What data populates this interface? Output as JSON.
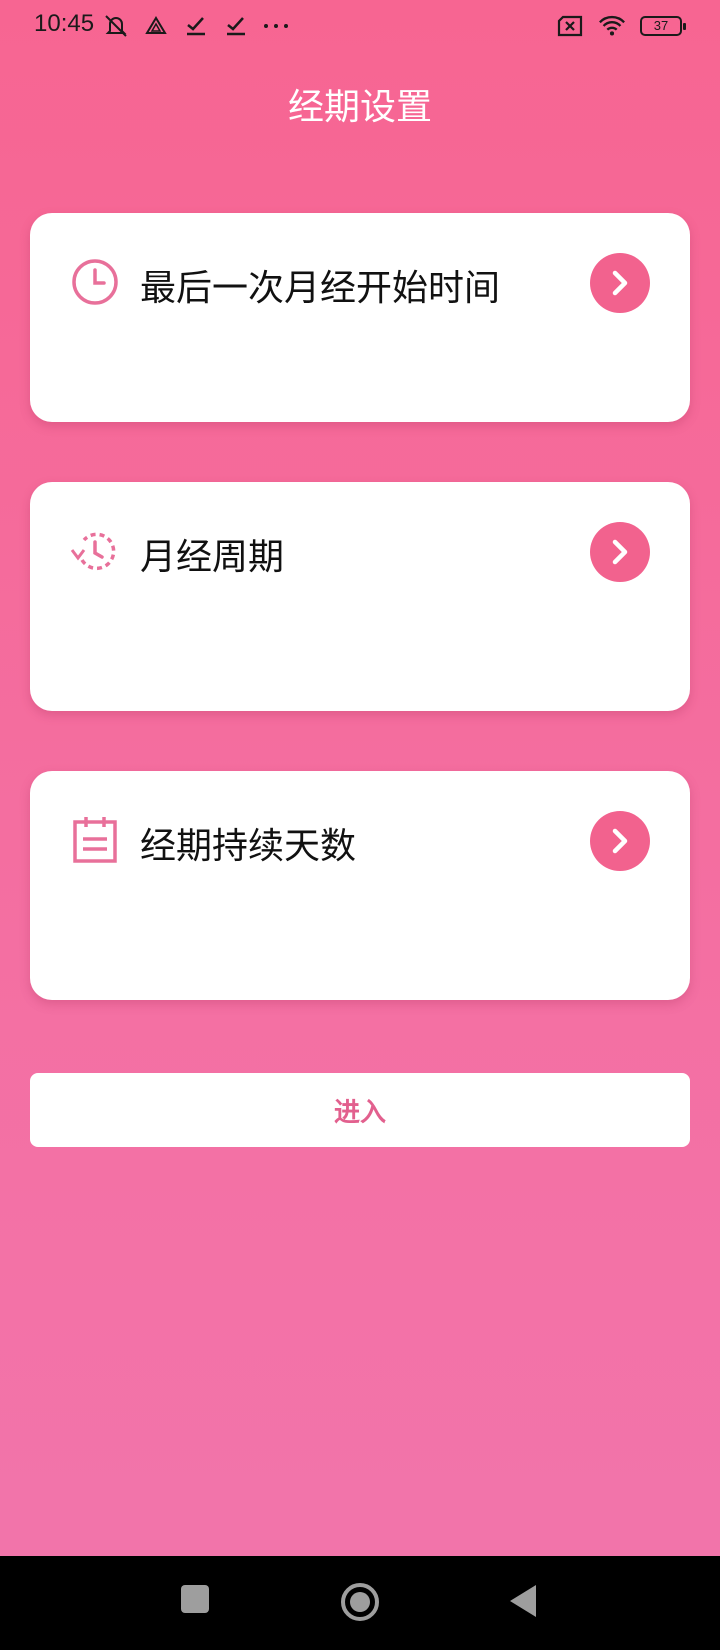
{
  "status_bar": {
    "time": "10:45",
    "left_icons": [
      "muted-bell-icon",
      "drive-icon",
      "check-icon",
      "check-icon",
      "more-dots-icon"
    ],
    "right_icons": [
      "no-sim-icon",
      "wifi-icon"
    ],
    "battery_level": "37"
  },
  "header": {
    "title": "经期设置"
  },
  "cards": [
    {
      "label": "最后一次月经开始时间",
      "icon": "clock-icon"
    },
    {
      "label": "月经周期",
      "icon": "cycle-timer-icon"
    },
    {
      "label": "经期持续天数",
      "icon": "calendar-icon"
    }
  ],
  "enter_button": {
    "label": "进入"
  },
  "nav_bar": {
    "buttons": [
      "recents-square-icon",
      "home-circle-icon",
      "back-triangle-icon"
    ]
  },
  "colors": {
    "background": "#F76592",
    "accent": "#F2628E",
    "card": "#FFFFFF"
  }
}
